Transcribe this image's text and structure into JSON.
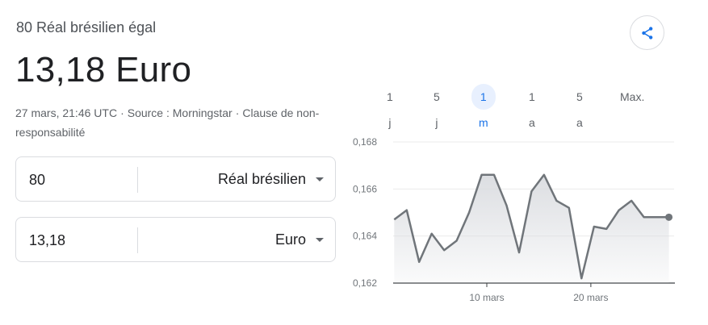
{
  "header": {
    "subtitle": "80 Réal brésilien égal",
    "result": "13,18 Euro",
    "timestamp": "27 mars, 21:46 UTC",
    "separator": "·",
    "source": "Source : Morningstar",
    "disclaimer": "Clause de non-responsabilité"
  },
  "share": {
    "icon": "share-icon"
  },
  "converter": {
    "from": {
      "amount": "80",
      "currency": "Réal brésilien"
    },
    "to": {
      "amount": "13,18",
      "currency": "Euro"
    }
  },
  "range_tabs": [
    {
      "label": "1 j",
      "active": false
    },
    {
      "label": "5 j",
      "active": false
    },
    {
      "label": "1 m",
      "active": true
    },
    {
      "label": "1 a",
      "active": false
    },
    {
      "label": "5 a",
      "active": false
    },
    {
      "label": "Max.",
      "active": false
    }
  ],
  "colors": {
    "line": "#70757a",
    "fill_top": "#dadce0",
    "grid": "#ebebeb",
    "accent": "#1a73e8"
  },
  "chart_data": {
    "type": "area",
    "ylim": [
      0.162,
      0.168
    ],
    "y_ticks": [
      "0,168",
      "0,166",
      "0,164",
      "0,162"
    ],
    "y_tick_values": [
      0.168,
      0.166,
      0.164,
      0.162
    ],
    "x_ticks": [
      "10 mars",
      "20 mars"
    ],
    "x_tick_days": [
      10,
      20
    ],
    "x_start_day": 1,
    "x_end_day": 28,
    "series": [
      {
        "x": [
          1.1,
          2.3,
          3.5,
          4.7,
          5.9,
          7.1,
          8.3,
          9.5,
          10.7,
          11.9,
          13.1,
          14.3,
          15.5,
          16.7,
          17.9,
          19.1,
          20.3,
          21.5,
          22.7,
          23.9,
          25.1,
          26.3,
          27.5
        ],
        "values": [
          0.1647,
          0.1651,
          0.1629,
          0.1641,
          0.1634,
          0.1638,
          0.165,
          0.1666,
          0.1666,
          0.1653,
          0.1633,
          0.1659,
          0.1666,
          0.1655,
          0.1652,
          0.1622,
          0.1644,
          0.1643,
          0.1651,
          0.1655,
          0.1648,
          0.1648,
          0.1648
        ]
      }
    ]
  }
}
